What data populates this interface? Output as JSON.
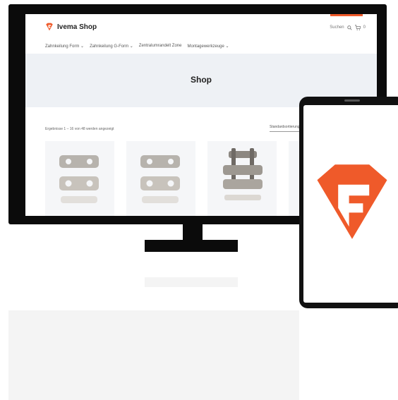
{
  "colors": {
    "accent": "#ef5a2a",
    "hero_bg": "#eef1f5",
    "frame": "#0b0b0b"
  },
  "header": {
    "brand_title": "Ivema Shop",
    "search_label": "Suchen",
    "search_icon": "search-icon",
    "cart_icon": "cart-icon",
    "cart_count": "0"
  },
  "nav": [
    {
      "label": "Zahnkeilung Form ⌄"
    },
    {
      "label": "Zahnkeilung G-Form ⌄"
    },
    {
      "label": "Zentralumrandelt Zone"
    },
    {
      "label": "Montagewerkzeuge ⌄"
    }
  ],
  "hero": {
    "title": "Shop"
  },
  "listing": {
    "result_count": "Ergebnisse 1 – 16 von 48 werden angezeigt",
    "sort_label": "Standardsortierung"
  },
  "products": [
    {
      "image": "flat-connector-plate-image"
    },
    {
      "image": "flat-connector-plate-image"
    },
    {
      "image": "chain-link-image"
    },
    {
      "image": "product-image"
    }
  ],
  "phone": {
    "logo": "ivema-logo"
  }
}
